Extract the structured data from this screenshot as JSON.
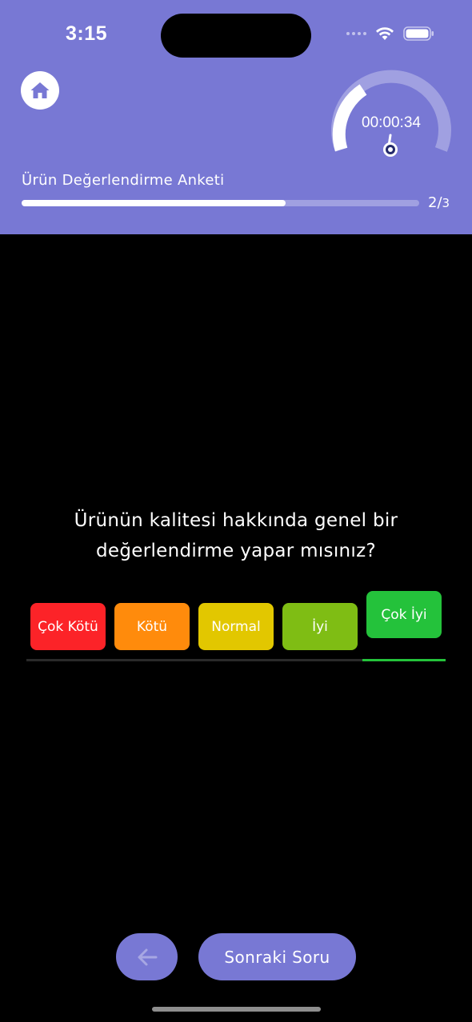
{
  "status_bar": {
    "time": "3:15"
  },
  "header": {
    "home_icon": "home-icon",
    "timer": "00:00:34",
    "survey_title": "Ürün Değerlendirme Anketi",
    "progress": {
      "current": "2",
      "separator": "/",
      "total": "3",
      "fraction": 0.667
    }
  },
  "question": {
    "text": "Ürünün kalitesi hakkında genel bir değerlendirme yapar mısınız?"
  },
  "options": [
    {
      "label": "Çok Kötü",
      "color": "#fc2328",
      "selected": false
    },
    {
      "label": "Kötü",
      "color": "#ff8b0c",
      "selected": false
    },
    {
      "label": "Normal",
      "color": "#e2c700",
      "selected": false
    },
    {
      "label": "İyi",
      "color": "#7fbd14",
      "selected": false
    },
    {
      "label": "Çok İyi",
      "color": "#24c23b",
      "selected": true
    }
  ],
  "navigation": {
    "back_icon": "arrow-left-icon",
    "next_label": "Sonraki Soru"
  },
  "colors": {
    "accent": "#7878d4",
    "selected_underline": "#24c23b",
    "unselected_underline": "#2a2a2a"
  }
}
